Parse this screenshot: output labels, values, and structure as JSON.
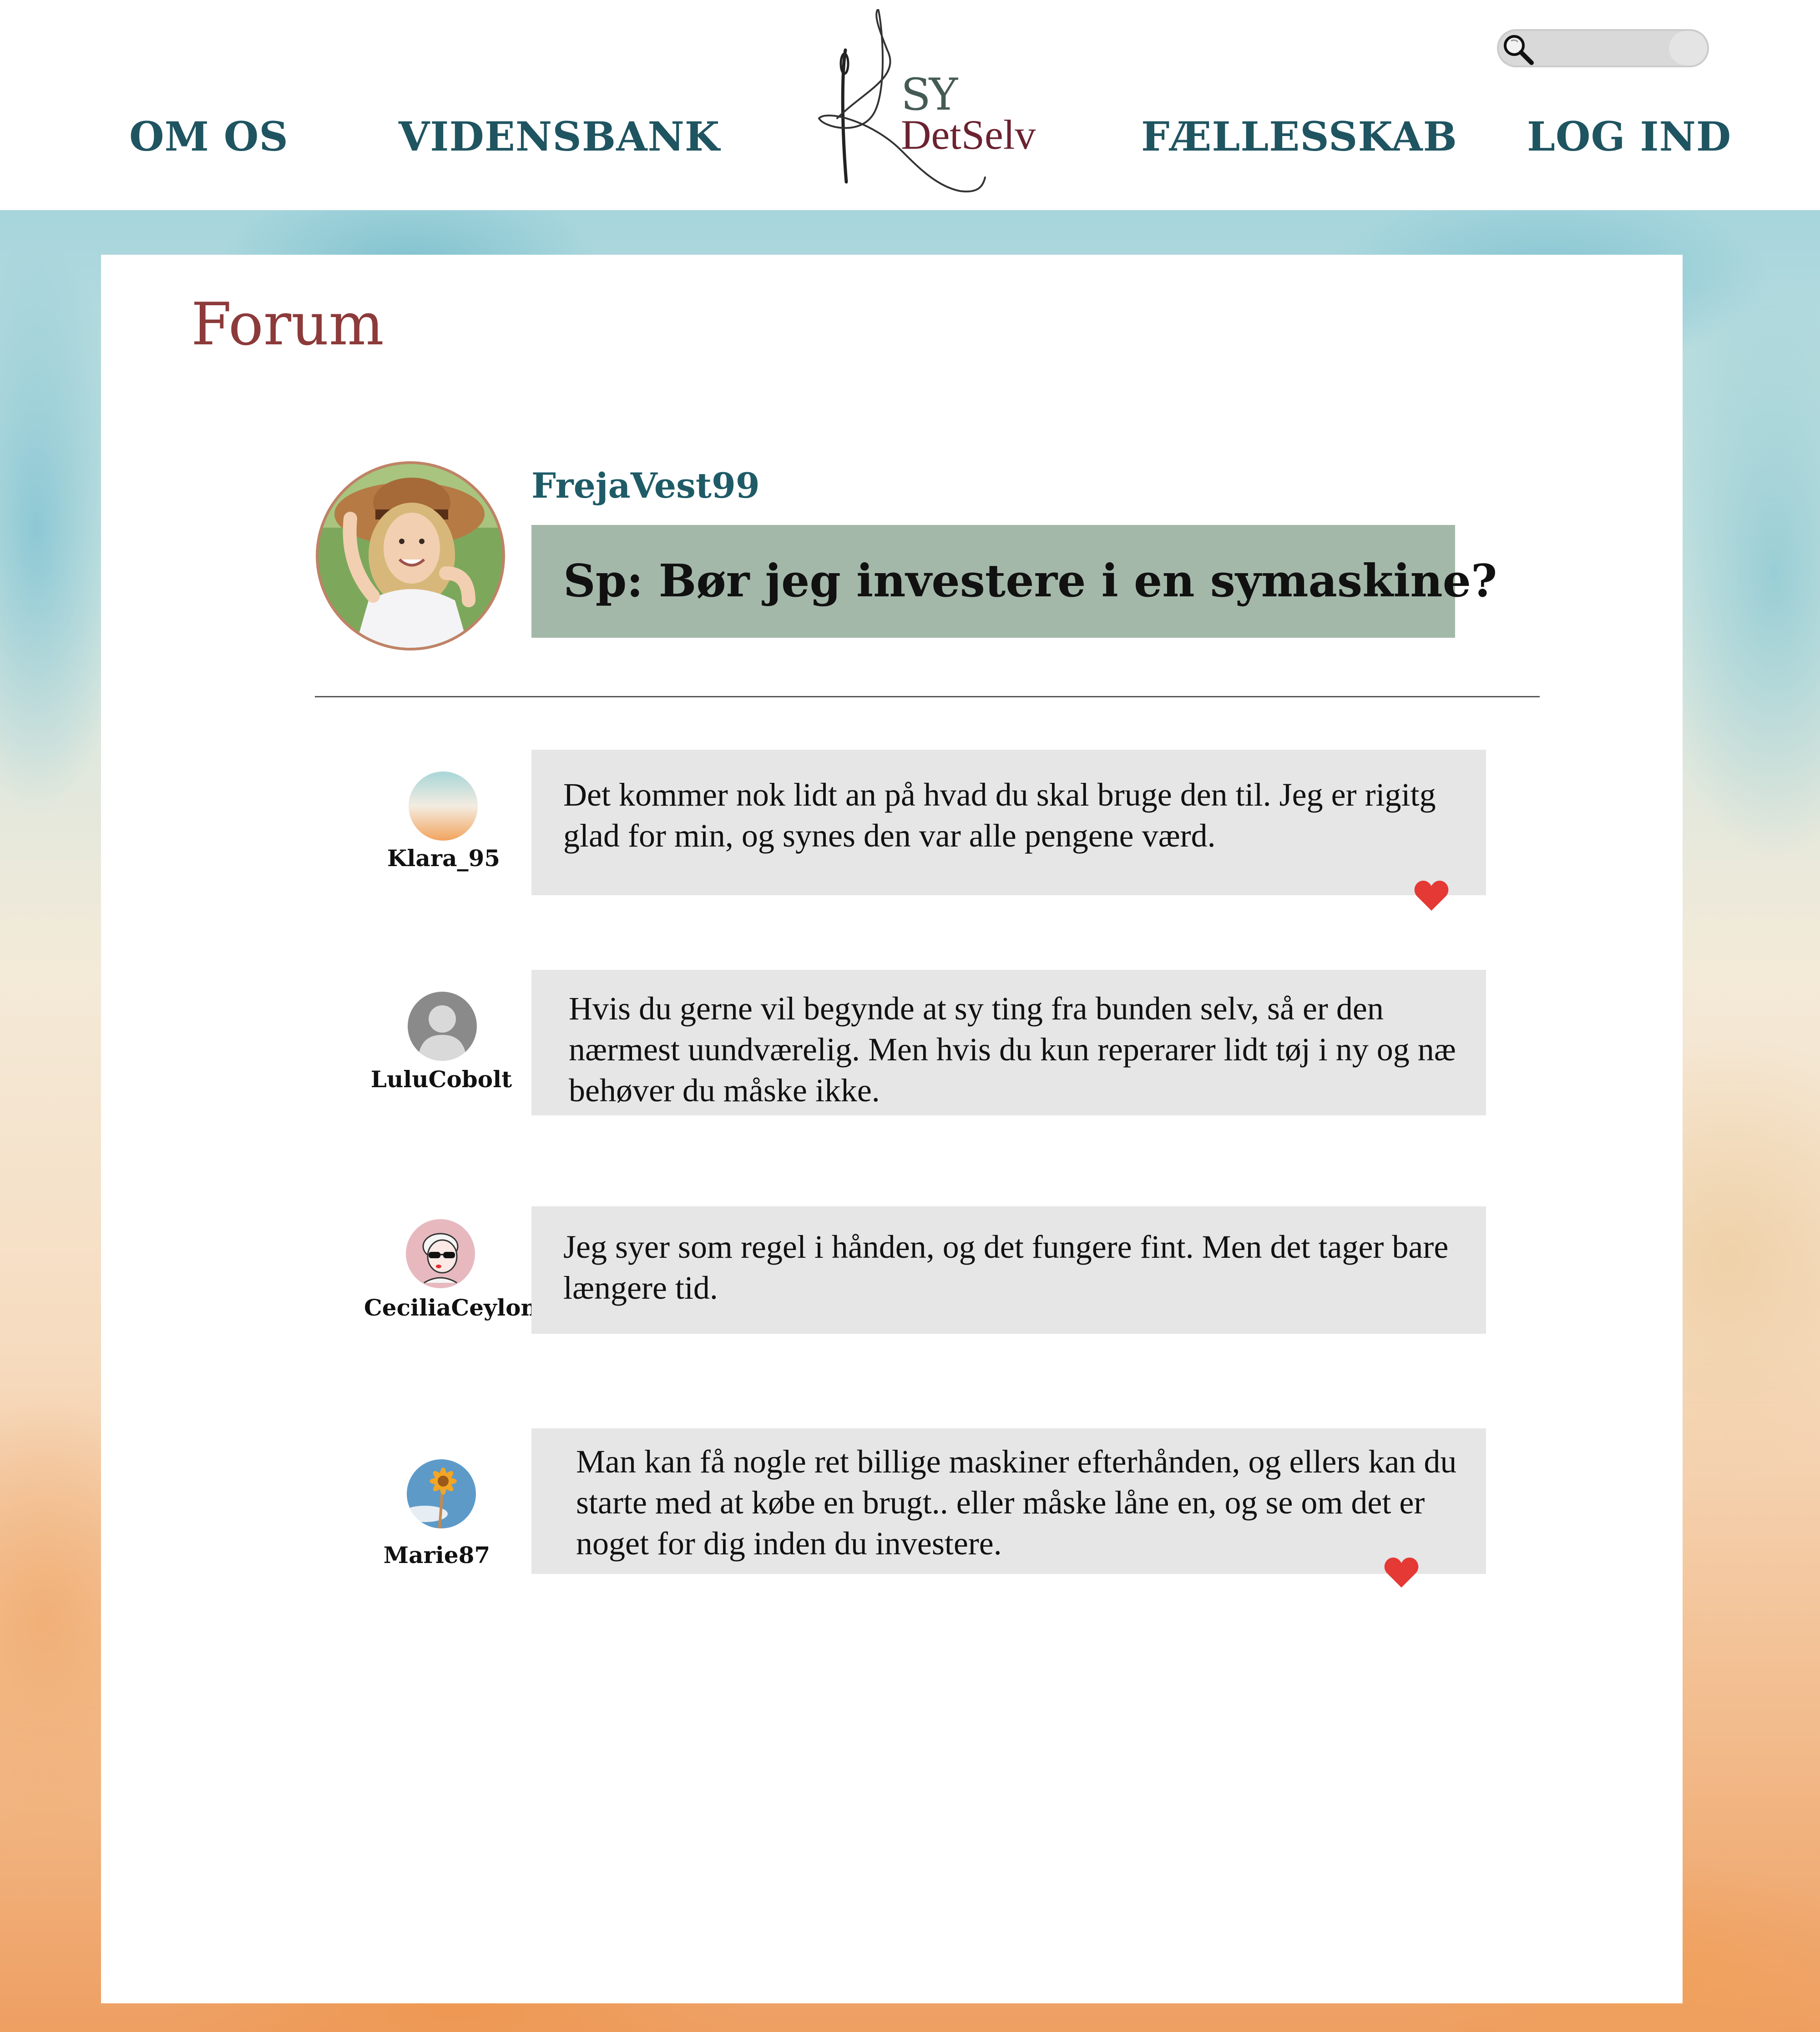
{
  "header": {
    "nav": {
      "om_os": "OM OS",
      "vidensbank": "VIDENSBANK",
      "faellesskab": "FÆLLESSKAB",
      "log_ind": "LOG IND"
    },
    "logo": {
      "line1": "SY",
      "line2": "DetSelv"
    },
    "search": {
      "placeholder": "",
      "icon": "search-icon"
    }
  },
  "page": {
    "title": "Forum"
  },
  "question": {
    "username": "FrejaVest99",
    "text": "Sp: Bør jeg investere i en symaskine?"
  },
  "replies": [
    {
      "username": "Klara_95",
      "text": "Det kommer nok lidt an på hvad du skal bruge den til. Jeg er rigitg glad for min, og synes den var alle pengene værd.",
      "liked": true
    },
    {
      "username": "LuluCobolt",
      "text": "Hvis du gerne vil begynde at sy ting fra bunden selv, så er den nærmest uundværelig. Men hvis du kun reperarer lidt tøj i ny og næ behøver du måske ikke.",
      "liked": false
    },
    {
      "username": "CeciliaCeylon",
      "text": "Jeg syer som regel i hånden, og det fungere fint. Men det tager bare længere tid.",
      "liked": false
    },
    {
      "username": "Marie87",
      "text": "Man kan få nogle ret billige maskiner efterhånden, og ellers kan du starte med at købe en brugt.. eller måske låne en, og se om det er noget for dig inden du investere.",
      "liked": true
    }
  ],
  "colors": {
    "nav": "#1f5461",
    "forum_title": "#8c3a3a",
    "question_box": "#a4b8aa",
    "reply_box": "#e6e6e6",
    "heart": "#e53935",
    "username": "#1e5b67"
  }
}
